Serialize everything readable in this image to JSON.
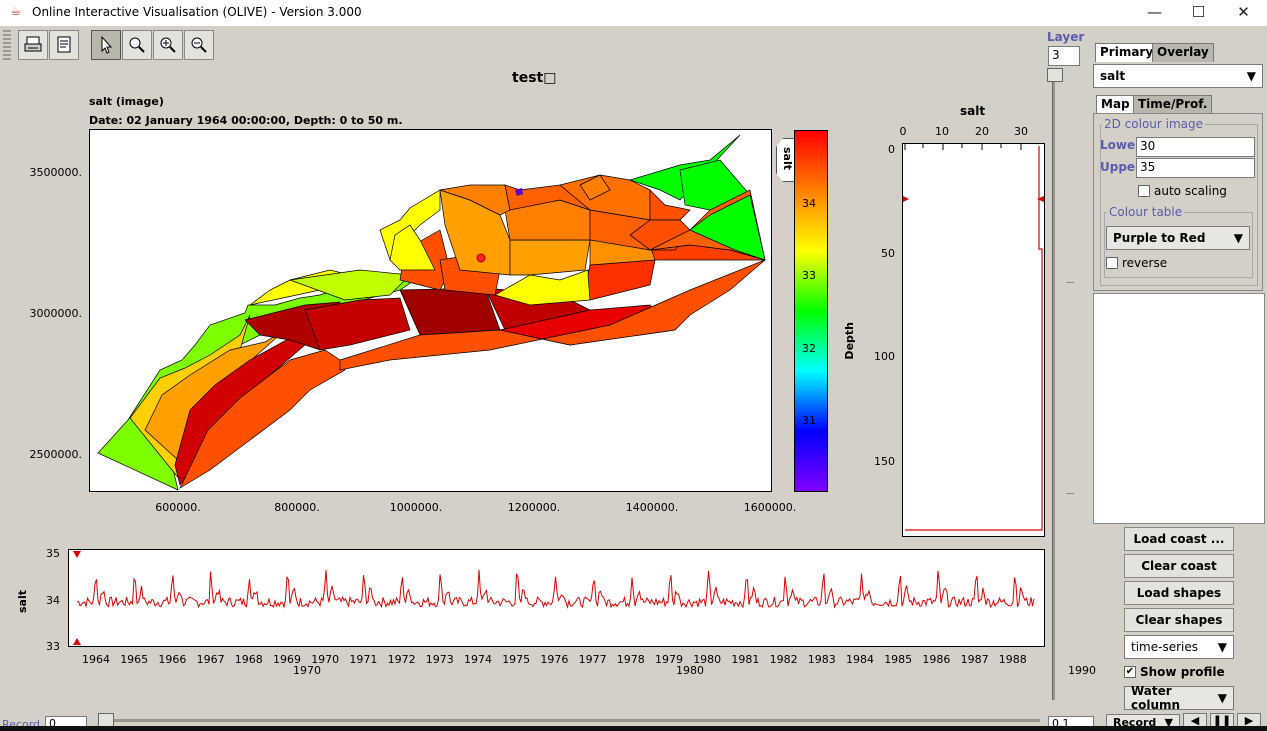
{
  "window": {
    "title": "Online Interactive Visualisation (OLIVE) - Version 3.000",
    "controls": {
      "minimize": "—",
      "maximize": "☐",
      "close": "✕"
    }
  },
  "toolbar": {
    "tools": [
      {
        "name": "print-icon"
      },
      {
        "name": "page-setup-icon"
      },
      {
        "name": "pointer-icon",
        "selected": true
      },
      {
        "name": "zoom-icon"
      },
      {
        "name": "zoom-in-icon"
      },
      {
        "name": "zoom-out-icon"
      }
    ]
  },
  "map": {
    "title": "test□",
    "variable_line": "salt (image)",
    "date_line": "Date: 02 January 1964 00:00:00, Depth: 0 to 50 m.",
    "y_ticks": [
      "3500000.",
      "3000000.",
      "2500000."
    ],
    "x_ticks": [
      "600000.",
      "800000.",
      "1000000.",
      "1200000.",
      "1400000.",
      "1600000."
    ]
  },
  "colorbar": {
    "label": "salt",
    "ticks": [
      "34",
      "33",
      "32",
      "31"
    ],
    "colors": [
      "#ff0000",
      "#ff8000",
      "#ffff00",
      "#00ff00",
      "#00ffff",
      "#0000ff",
      "#8000ff"
    ]
  },
  "profile": {
    "x_label": "salt",
    "x_ticks": [
      "0",
      "10",
      "20",
      "30"
    ],
    "y_label": "Depth",
    "y_ticks": [
      "0",
      "50",
      "100",
      "150"
    ]
  },
  "timeseries": {
    "y_label": "salt",
    "y_ticks": [
      "35",
      "34",
      "33"
    ],
    "years": [
      "1964",
      "1965",
      "1966",
      "1967",
      "1968",
      "1969",
      "1970",
      "1971",
      "1972",
      "1973",
      "1974",
      "1975",
      "1976",
      "1977",
      "1978",
      "1979",
      "1980",
      "1981",
      "1982",
      "1983",
      "1984",
      "1985",
      "1986",
      "1987",
      "1988"
    ],
    "decade_labels": [
      "1970",
      "1980",
      "1990"
    ]
  },
  "layer": {
    "label": "Layer",
    "value": "3"
  },
  "panel": {
    "tabs": [
      "Primary",
      "Overlay"
    ],
    "variable": "salt",
    "subtabs": [
      "Map",
      "Time/Prof."
    ],
    "colour_group_title": "2D colour image",
    "lower_label": "Lower",
    "lower_value": "30",
    "upper_label": "Upper",
    "upper_value": "35",
    "auto_scaling_label": "auto scaling",
    "auto_scaling_checked": false,
    "colour_table_title": "Colour table",
    "colour_table_value": "Purple to Red",
    "reverse_label": "reverse",
    "reverse_checked": false
  },
  "buttons": {
    "load_coast": "Load coast ...",
    "clear_coast": "Clear coast",
    "load_shapes": "Load shapes",
    "clear_shapes": "Clear shapes"
  },
  "plot_type": "time-series",
  "show_profile": {
    "label": "Show profile",
    "checked": true
  },
  "profile_mode": "Water column",
  "bottom": {
    "record_label": "Record",
    "record_value": "0",
    "speed_value": "0.1",
    "record_combo": "Record"
  }
}
